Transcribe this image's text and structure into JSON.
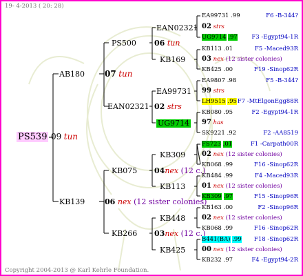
{
  "header": {
    "date": "19- 4-2013 ( 20: 28)"
  },
  "footer": {
    "copyright": "Copyright 2004-2013 @ Karl Kehrle Foundation."
  },
  "root": {
    "id": "PS539",
    "gen": "09",
    "race": "tun"
  },
  "gen2": {
    "ab180": {
      "id": "AB180",
      "gen": "07",
      "race": "tun"
    },
    "kb139": {
      "id": "KB139",
      "gen": "06",
      "race": "nex",
      "note": "(12 sister colonies)"
    }
  },
  "gen3": {
    "ps500": {
      "id": "PS500",
      "gen": "06",
      "race": "tun"
    },
    "ean02321": {
      "id": "EAN02321",
      "gen": "02",
      "race": "strs"
    },
    "kb075": {
      "id": "KB075",
      "gen": "04",
      "race": "nex",
      "note": "(12 c.)"
    },
    "kb266": {
      "id": "KB266",
      "gen": "03",
      "race": "nex",
      "note": "(12 c.)"
    }
  },
  "gen4": {
    "ean02321": {
      "id": "EAN02321"
    },
    "kb169": {
      "id": "KB169"
    },
    "ea99731": {
      "id": "EA99731"
    },
    "ug9714": {
      "id": "UG9714"
    },
    "kb309": {
      "id": "KB309"
    },
    "kb113": {
      "id": "KB113"
    },
    "kb448": {
      "id": "KB448"
    },
    "kb425": {
      "id": "KB425"
    }
  },
  "gen5": [
    {
      "id": "EA99731",
      "val": ".99",
      "code": "F6 -B-344?"
    },
    {
      "gen": "02",
      "race": "strs"
    },
    {
      "id": "UG9714",
      "val": ".97",
      "code": "F3 -Egypt94-1R"
    },
    {
      "id": "KB113",
      "val": ".01",
      "code": "F5 -Maced93R"
    },
    {
      "gen": "03",
      "race": "nex",
      "note": "(12 sister colonies)"
    },
    {
      "id": "KB425",
      "val": ".00",
      "code": "F19 -Sinop62R"
    },
    {
      "id": "EA9807",
      "val": ".98",
      "code": "F5 -B-344?"
    },
    {
      "gen": "99",
      "race": "strs"
    },
    {
      "id": "LH9515",
      "val": ".95",
      "code": "F7 -MtElgonEgg88R"
    },
    {
      "id": "KB080",
      "val": ".95",
      "code": "F2 -Egypt94-1R"
    },
    {
      "gen": "97",
      "race": "has"
    },
    {
      "id": "SK9221",
      "val": ".92",
      "code": "F2 -AA8519"
    },
    {
      "id": "FS723",
      "val": ".01",
      "code": "F1 -Carpath00R"
    },
    {
      "gen": "02",
      "race": "nex",
      "note": "(12 sister colonies)"
    },
    {
      "id": "KB068",
      "val": ".99",
      "code": "F16 -Sinop62R"
    },
    {
      "id": "KB484",
      "val": ".99",
      "code": "F4 -Maced93R"
    },
    {
      "gen": "01",
      "race": "nex",
      "note": "(12 sister colonies)"
    },
    {
      "id": "KB309",
      "val": ".97",
      "code": "F15 -Sinop96R"
    },
    {
      "id": "KB163",
      "val": ".00",
      "code": "F2 -Sinop96R"
    },
    {
      "gen": "02",
      "race": "nex",
      "note": "(12 sister colonies)"
    },
    {
      "id": "KB068",
      "val": ".99",
      "code": "F16 -Sinop62R"
    },
    {
      "id": "B441(BA)",
      "val": ".99",
      "code": "F18 -Sinop62R"
    },
    {
      "gen": "00",
      "race": "nex",
      "note": "(12 sister colonies)"
    },
    {
      "id": "KB232",
      "val": ".97",
      "code": "F4 -Egypt94-2R"
    }
  ]
}
